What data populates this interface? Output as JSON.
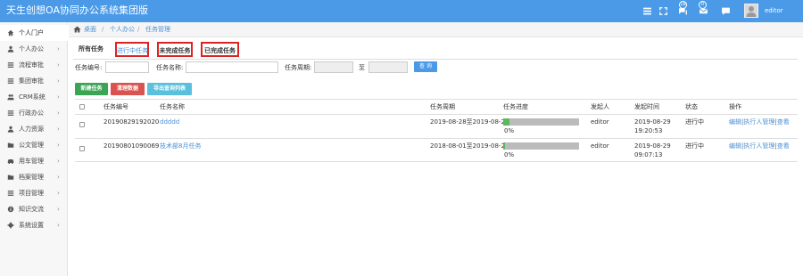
{
  "header": {
    "title": "天生创想OA协同办公系统集团版",
    "badge_1": "18",
    "badge_2": "0",
    "username": "editor"
  },
  "sidebar": {
    "items": [
      {
        "label": "个人门户",
        "icon": "home-icon",
        "arrow": ""
      },
      {
        "label": "个人办公",
        "icon": "user-icon",
        "arrow": "›"
      },
      {
        "label": "流程审批",
        "icon": "list-icon",
        "arrow": "›"
      },
      {
        "label": "集团审批",
        "icon": "list-icon",
        "arrow": "›"
      },
      {
        "label": "CRM系统",
        "icon": "users-icon",
        "arrow": "›"
      },
      {
        "label": "行政办公",
        "icon": "list-icon",
        "arrow": "›"
      },
      {
        "label": "人力资源",
        "icon": "user-icon",
        "arrow": "›"
      },
      {
        "label": "公文管理",
        "icon": "folder-icon",
        "arrow": "›"
      },
      {
        "label": "用车管理",
        "icon": "car-icon",
        "arrow": "›"
      },
      {
        "label": "档案管理",
        "icon": "folder-icon",
        "arrow": "›"
      },
      {
        "label": "项目管理",
        "icon": "list-icon",
        "arrow": "›"
      },
      {
        "label": "知识交流",
        "icon": "info-icon",
        "arrow": "›"
      },
      {
        "label": "系统设置",
        "icon": "gear-icon",
        "arrow": "›"
      }
    ]
  },
  "breadcrumb": {
    "home": "桌面",
    "sep": "/",
    "level1": "个人办公",
    "level2": "任务管理"
  },
  "tabs": {
    "all": "所有任务",
    "in_progress": "进行中任务",
    "incomplete": "未完成任务",
    "completed": "已完成任务"
  },
  "filters": {
    "task_no_label": "任务编号:",
    "task_name_label": "任务名称:",
    "period_label": "任务周期:",
    "to_label": "至",
    "search_button": "查 询"
  },
  "actions": {
    "new_task": "新建任务",
    "clear_data": "清理数据",
    "export": "导出查询列表"
  },
  "table": {
    "headers": [
      "任务编号",
      "任务名称",
      "任务周期",
      "任务进度",
      "发起人",
      "发起时间",
      "状态",
      "操作"
    ],
    "rows": [
      {
        "no": "20190829192020",
        "name": "ddddd",
        "period": "2019-08-28至2019-08-29",
        "progress_text": "0%",
        "progress_value": 0.08,
        "initiator": "editor",
        "time_date": "2019-08-29",
        "time_clock": "19:20:53",
        "status": "进行中",
        "op_edit": "编辑",
        "op_exec": "执行人管理",
        "op_view": "查看",
        "sep": "|"
      },
      {
        "no": "20190801090069",
        "name": "技术部8月任务",
        "period": "2018-08-01至2019-08-29",
        "progress_text": "0%",
        "progress_value": 0.02,
        "initiator": "editor",
        "time_date": "2019-08-29",
        "time_clock": "09:07:13",
        "status": "进行中",
        "op_edit": "编辑",
        "op_exec": "执行人管理",
        "op_view": "查看",
        "sep": "|"
      }
    ]
  },
  "colors": {
    "accent": "#4a9ae8",
    "tab_highlight": "#dd2222",
    "green": "#3aa655",
    "red": "#d9534f",
    "teal": "#5bc0de"
  }
}
